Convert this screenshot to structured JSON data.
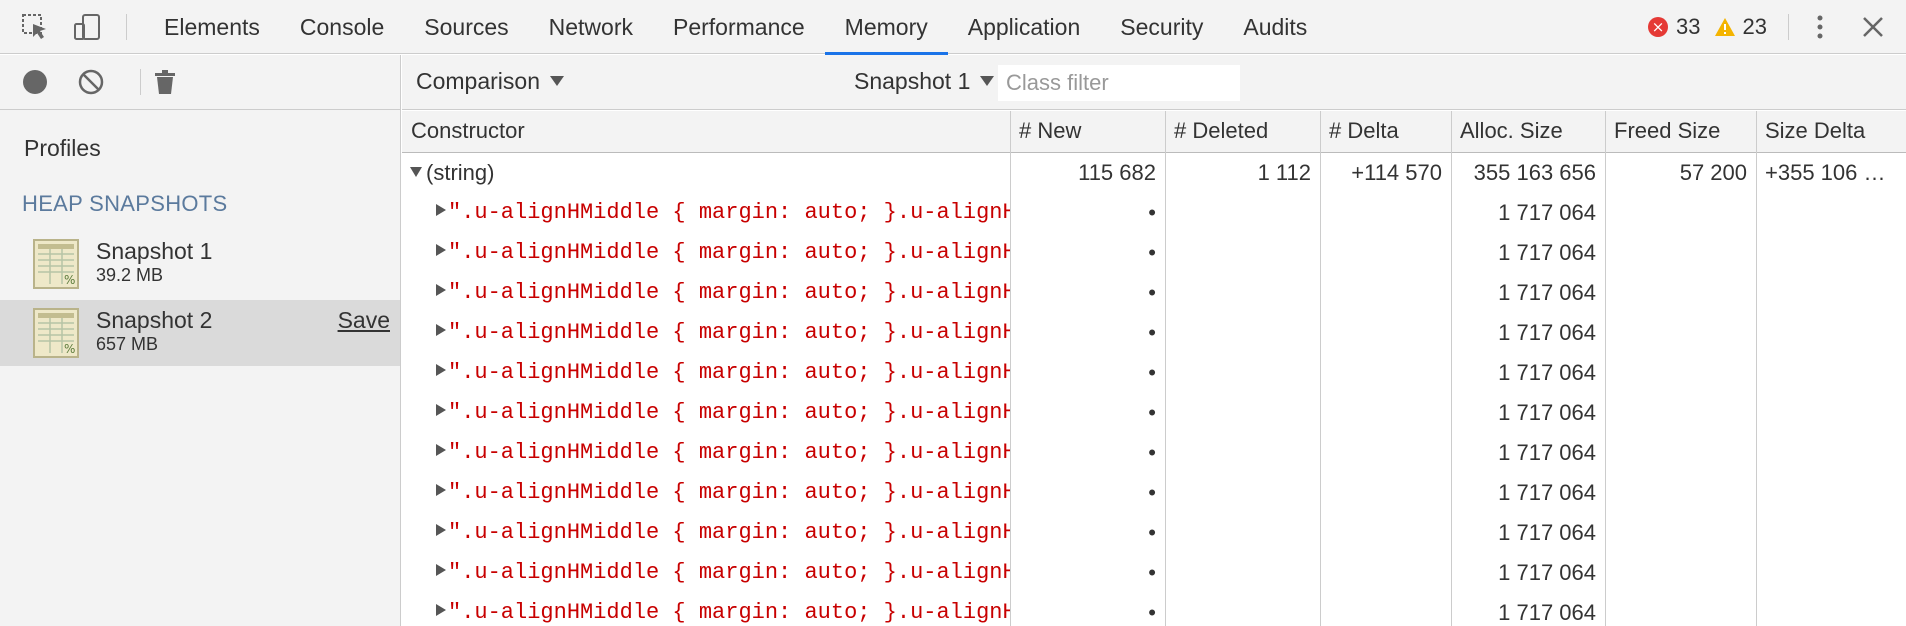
{
  "tabs": [
    {
      "label": "Elements",
      "active": false
    },
    {
      "label": "Console",
      "active": false
    },
    {
      "label": "Sources",
      "active": false
    },
    {
      "label": "Network",
      "active": false
    },
    {
      "label": "Performance",
      "active": false
    },
    {
      "label": "Memory",
      "active": true
    },
    {
      "label": "Application",
      "active": false
    },
    {
      "label": "Security",
      "active": false
    },
    {
      "label": "Audits",
      "active": false
    }
  ],
  "counters": {
    "errors": "33",
    "warnings": "23"
  },
  "sidebar": {
    "profiles_title": "Profiles",
    "heap_title": "HEAP SNAPSHOTS",
    "snapshots": [
      {
        "name": "Snapshot 1",
        "size": "39.2 MB",
        "selected": false
      },
      {
        "name": "Snapshot 2",
        "size": "657 MB",
        "selected": true,
        "action": "Save"
      }
    ]
  },
  "toolbar": {
    "view_label": "Comparison",
    "class_filter_placeholder": "Class filter",
    "base_snapshot_label": "Snapshot 1"
  },
  "grid": {
    "columns": [
      "Constructor",
      "# New",
      "# Deleted",
      "# Delta",
      "Alloc. Size",
      "Freed Size",
      "Size Delta"
    ],
    "root": {
      "constructor": "(string)",
      "new": "115 682",
      "deleted": "1 112",
      "delta": "+114 570",
      "alloc": "355 163 656",
      "freed": "57 200",
      "size_delta": "+355 106 …"
    },
    "children": [
      {
        "constructor": "\".u-alignHMiddle { margin: auto; }.u-alignHMiddle { margin: auto; }",
        "new": "•",
        "alloc": "1 717 064"
      },
      {
        "constructor": "\".u-alignHMiddle { margin: auto; }.u-alignHMiddle { margin: auto; }",
        "new": "•",
        "alloc": "1 717 064"
      },
      {
        "constructor": "\".u-alignHMiddle { margin: auto; }.u-alignHMiddle { margin: auto; }",
        "new": "•",
        "alloc": "1 717 064"
      },
      {
        "constructor": "\".u-alignHMiddle { margin: auto; }.u-alignHMiddle { margin: auto; }",
        "new": "•",
        "alloc": "1 717 064"
      },
      {
        "constructor": "\".u-alignHMiddle { margin: auto; }.u-alignHMiddle { margin: auto; }",
        "new": "•",
        "alloc": "1 717 064"
      },
      {
        "constructor": "\".u-alignHMiddle { margin: auto; }.u-alignHMiddle { margin: auto; }",
        "new": "•",
        "alloc": "1 717 064"
      },
      {
        "constructor": "\".u-alignHMiddle { margin: auto; }.u-alignHMiddle { margin: auto; }",
        "new": "•",
        "alloc": "1 717 064"
      },
      {
        "constructor": "\".u-alignHMiddle { margin: auto; }.u-alignHMiddle { margin: auto; }",
        "new": "•",
        "alloc": "1 717 064"
      },
      {
        "constructor": "\".u-alignHMiddle { margin: auto; }.u-alignHMiddle { margin: auto; }",
        "new": "•",
        "alloc": "1 717 064"
      },
      {
        "constructor": "\".u-alignHMiddle { margin: auto; }.u-alignHMiddle { margin: auto; }",
        "new": "•",
        "alloc": "1 717 064"
      },
      {
        "constructor": "\".u-alignHMiddle { margin: auto; }.u-alignHMiddle { margin: auto; }",
        "new": "•",
        "alloc": "1 717 064"
      }
    ]
  },
  "colors": {
    "accent": "#1a73e8",
    "error": "#e53935",
    "warning": "#f4b400",
    "string_value": "#c80000"
  }
}
